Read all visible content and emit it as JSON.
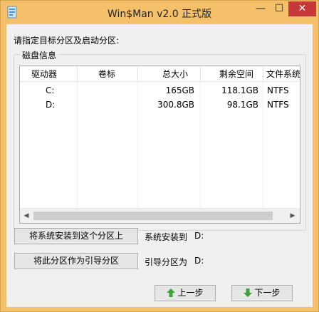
{
  "window": {
    "title": "Win$Man v2.0 正式版",
    "minimize_glyph": "—",
    "maximize_glyph": "☐",
    "close_glyph": "✕"
  },
  "instruction": "请指定目标分区及启动分区:",
  "group_caption": "磁盘信息",
  "table": {
    "headers": [
      "驱动器",
      "卷标",
      "总大小",
      "剩余空间",
      "文件系统"
    ],
    "rows": [
      {
        "drive": "C:",
        "label": "",
        "total": "165GB",
        "free": "118.1GB",
        "fs": "NTFS"
      },
      {
        "drive": "D:",
        "label": "",
        "total": "300.8GB",
        "free": "98.1GB",
        "fs": "NTFS"
      }
    ]
  },
  "actions": {
    "install_button": "将系统安装到这个分区上",
    "install_label": "系统安装到",
    "install_value": "D:",
    "boot_button": "将此分区作为引导分区",
    "boot_label": "引导分区为",
    "boot_value": "D:"
  },
  "nav": {
    "prev_button": "上一步",
    "next_button": "下一步"
  },
  "colors": {
    "titlebar": "#f4c06a",
    "close_button": "#c7383a",
    "arrow_green": "#3aa33a"
  },
  "icons": {
    "app": "app-icon",
    "prev": "green-up-arrow-icon",
    "next": "green-down-arrow-icon"
  }
}
